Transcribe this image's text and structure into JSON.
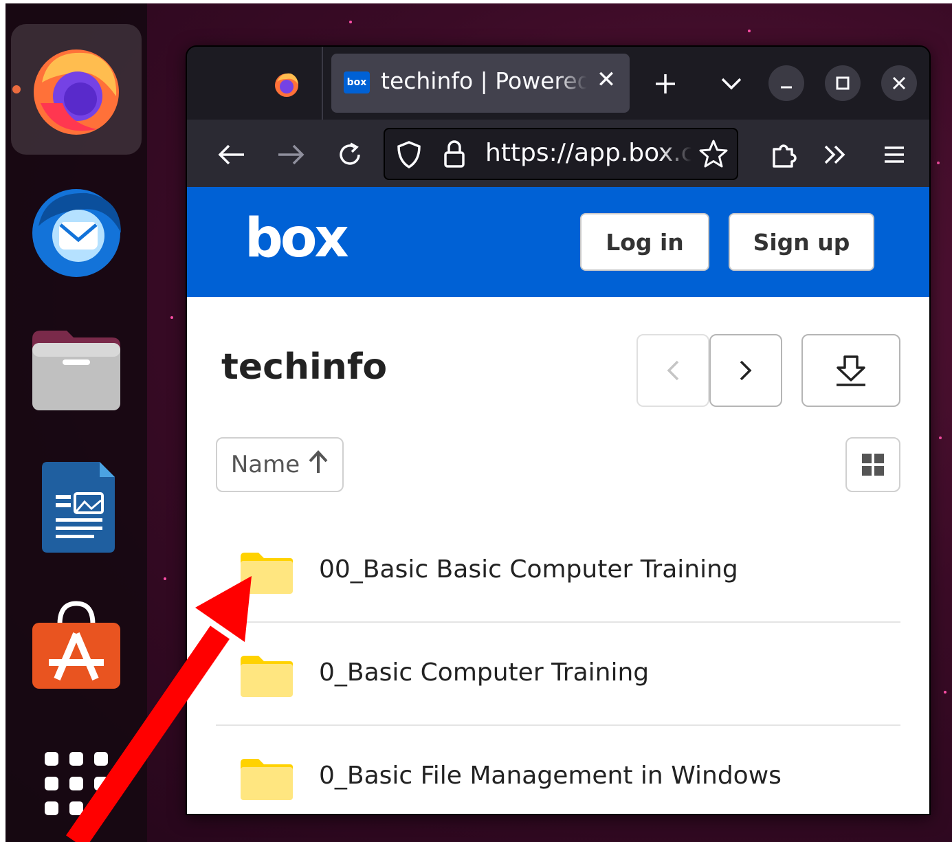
{
  "browser": {
    "tab_title": "techinfo | Powered by Box",
    "tab_favicon_text": "box",
    "url": "https://app.box.com"
  },
  "box": {
    "logo_text": "box",
    "login_label": "Log in",
    "signup_label": "Sign up",
    "folder_title": "techinfo",
    "sort_label": "Name",
    "brand_color": "#0061d5",
    "items": [
      {
        "name": "00_Basic Basic Computer Training"
      },
      {
        "name": "0_Basic Computer Training"
      },
      {
        "name": "0_Basic File Management in Windows"
      }
    ]
  },
  "dock": {
    "apps": [
      "firefox-icon",
      "thunderbird-icon",
      "files-icon",
      "libreoffice-impress-icon",
      "app-center-icon",
      "show-apps-icon"
    ]
  },
  "annotation": {
    "arrow_color": "#ff0000"
  }
}
